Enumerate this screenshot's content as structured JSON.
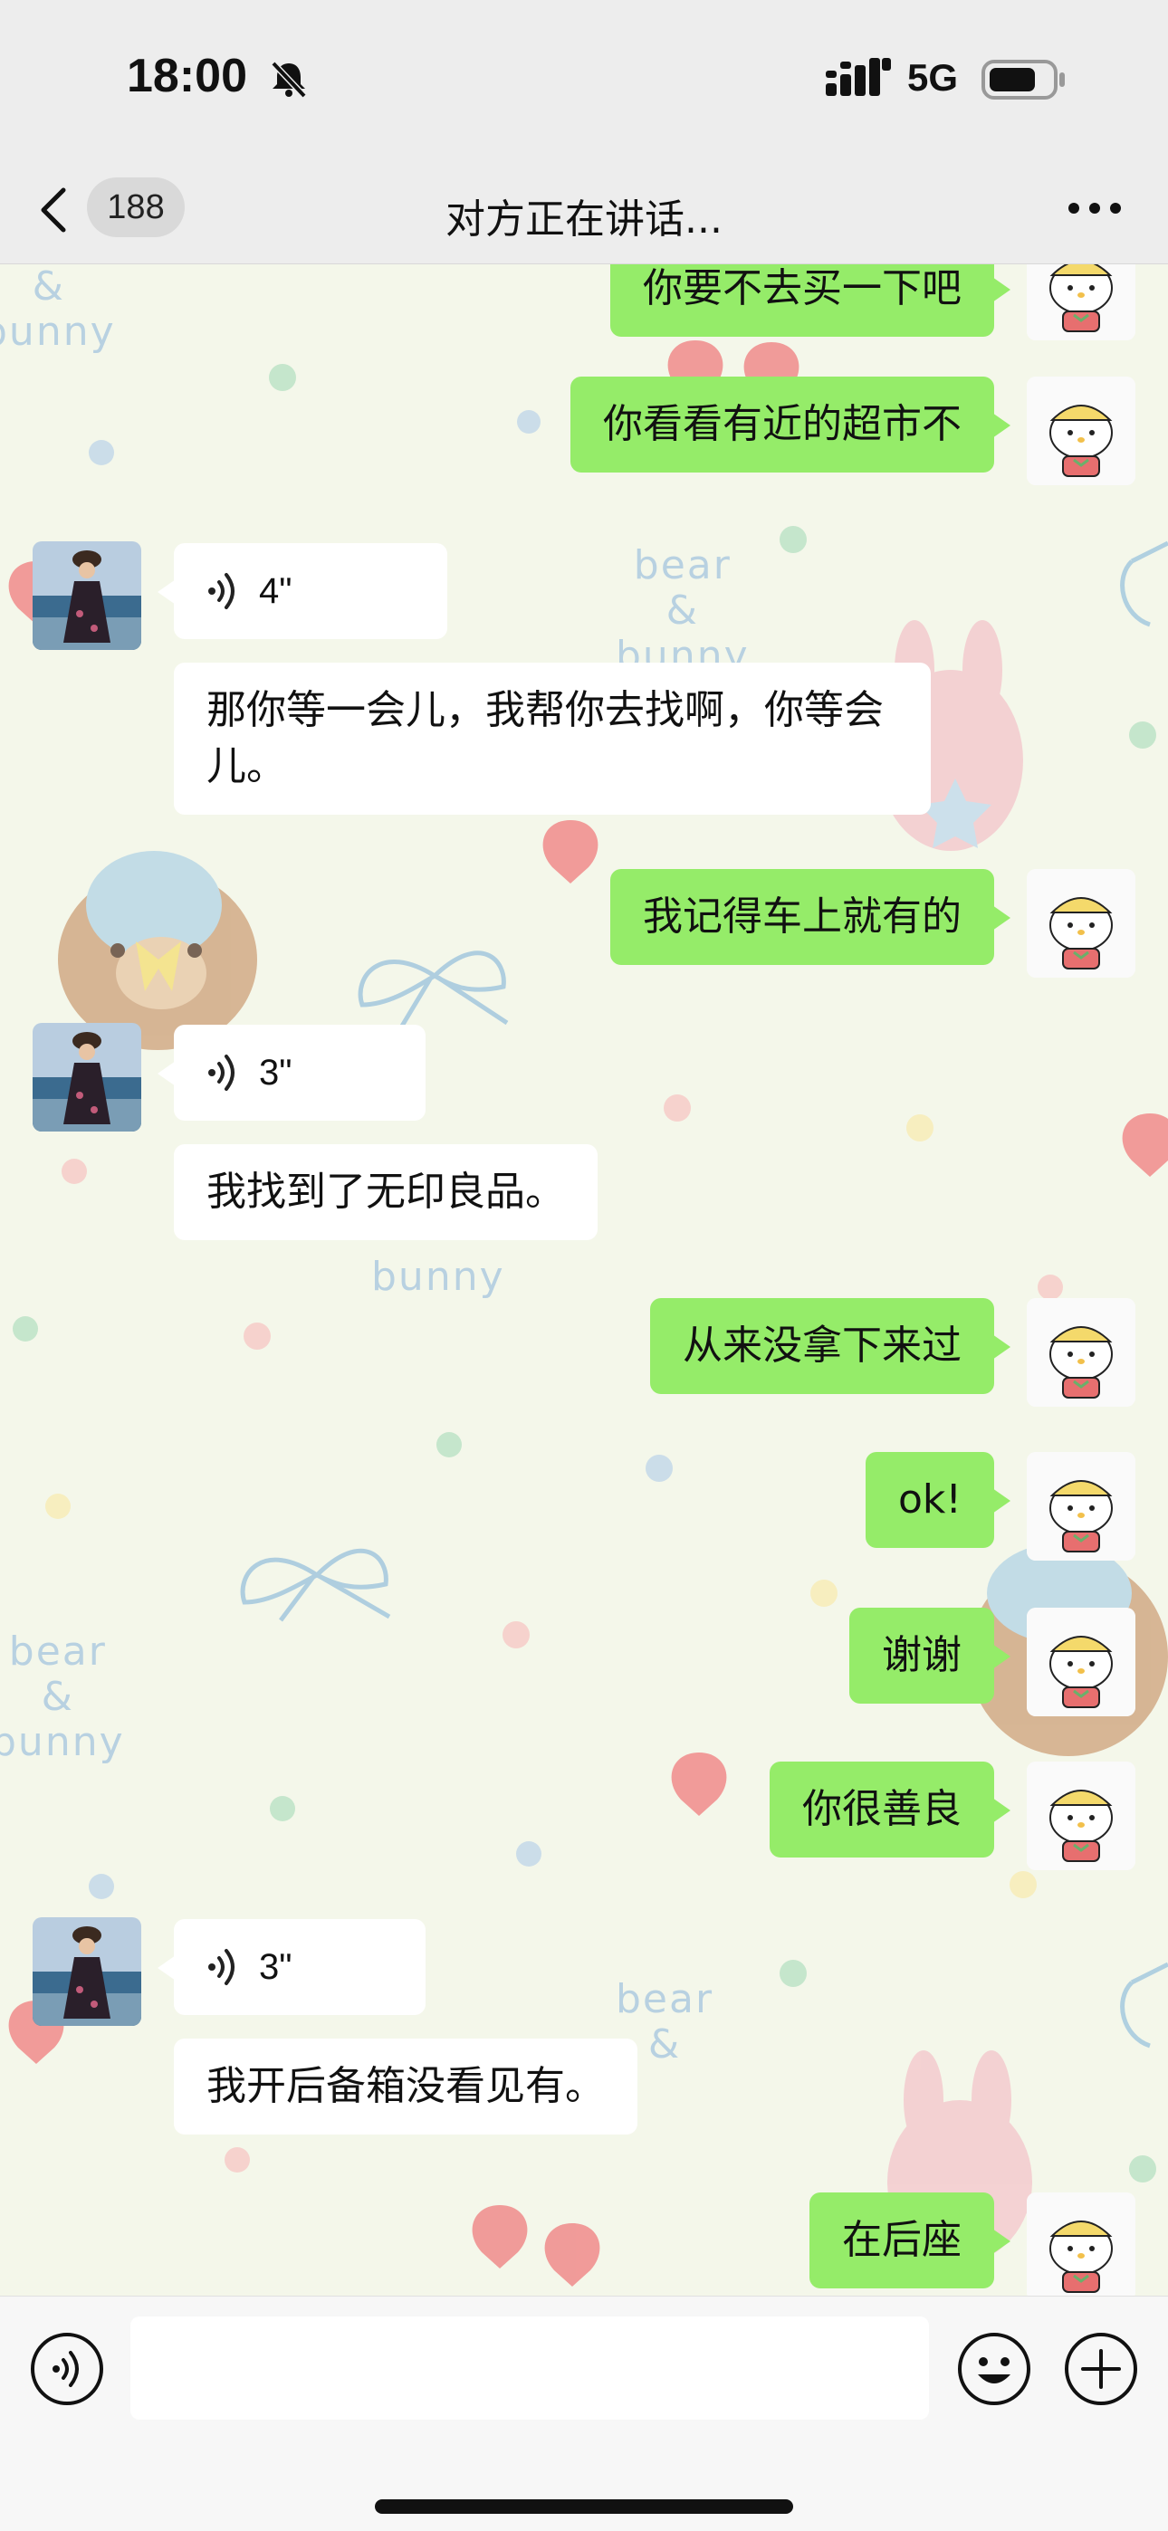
{
  "status_bar": {
    "time": "18:00",
    "network": "5G"
  },
  "nav": {
    "unread_count": "188",
    "title": "对方正在讲话..."
  },
  "wallpaper": {
    "watermarks": [
      "bear",
      "&",
      "bunny"
    ]
  },
  "messages": [
    {
      "side": "me",
      "type": "text",
      "text": "你要不去买一下吧"
    },
    {
      "side": "me",
      "type": "text",
      "text": "你看看有近的超市不"
    },
    {
      "side": "peer",
      "type": "voice",
      "duration": "4\""
    },
    {
      "side": "peer",
      "type": "text",
      "text": "那你等一会儿，我帮你去找啊，你等会儿。"
    },
    {
      "side": "me",
      "type": "text",
      "text": "我记得车上就有的"
    },
    {
      "side": "peer",
      "type": "voice",
      "duration": "3\""
    },
    {
      "side": "peer",
      "type": "text",
      "text": "我找到了无印良品。"
    },
    {
      "side": "me",
      "type": "text",
      "text": "从来没拿下来过"
    },
    {
      "side": "me",
      "type": "text",
      "text": "ok!"
    },
    {
      "side": "me",
      "type": "text",
      "text": "谢谢"
    },
    {
      "side": "me",
      "type": "text",
      "text": "你很善良"
    },
    {
      "side": "peer",
      "type": "voice",
      "duration": "3\""
    },
    {
      "side": "peer",
      "type": "text",
      "text": "我开后备箱没看见有。"
    },
    {
      "side": "me",
      "type": "text",
      "text": "在后座"
    }
  ],
  "icons": {
    "mute": "bell-slash-icon",
    "signal": "signal-bars-icon",
    "battery": "battery-icon",
    "back": "chevron-left-icon",
    "more": "more-dots-icon",
    "voice_toggle": "voice-wave-icon",
    "emoji": "smiley-icon",
    "add": "plus-circle-icon"
  },
  "colors": {
    "my_bubble": "#95ec69",
    "peer_bubble": "#ffffff",
    "header_bg": "#ededed",
    "wallpaper_bg": "#f4f7ea"
  }
}
